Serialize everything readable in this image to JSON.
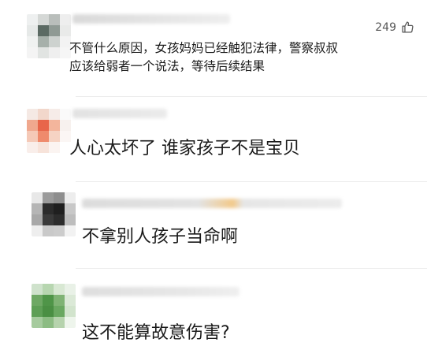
{
  "comments": [
    {
      "avatar_colors": [
        "#eef0f0",
        "#d5d8d6",
        "#b9bebb",
        "#eeeeee",
        "#e6e9e8",
        "#5b6a63",
        "#8f9a94",
        "#e9eae9",
        "#f0f2f1",
        "#a6b0aa",
        "#cdd2cf",
        "#f3f3f3",
        "#f4f4f4",
        "#e1e4e2",
        "#efefef",
        "#f6f6f6"
      ],
      "text_lines": [
        "不管什么原因，女孩妈妈已经触犯法律，警察叔叔",
        "应该给弱者一个说法，等待后续结果"
      ],
      "like_count": "249"
    },
    {
      "avatar_colors": [
        "#f5e9e4",
        "#f2d7cb",
        "#f6ece8",
        "#fafafa",
        "#f0a88e",
        "#e8664a",
        "#f3b59c",
        "#f7f1ee",
        "#f5c9b7",
        "#ef8a6c",
        "#f6d3c3",
        "#fbf6f4",
        "#f9eeea",
        "#f7e3da",
        "#fbf4f1",
        "#ffffff"
      ],
      "text": "人心太坏了 谁家孩子不是宝贝"
    },
    {
      "avatar_colors": [
        "#e8e8e8",
        "#9b9b9b",
        "#8e8e8e",
        "#ededed",
        "#b5b5b5",
        "#2b2b2b",
        "#1f1f1f",
        "#c8c8c8",
        "#a8a8a8",
        "#3a3a3a",
        "#2c2c2c",
        "#bdbdbd",
        "#eeeeee",
        "#c9c9c9",
        "#cccccc",
        "#f2f2f2"
      ],
      "text": "不拿别人孩子当命啊"
    },
    {
      "avatar_colors": [
        "#cfe2cc",
        "#b7d6b0",
        "#d8e8d3",
        "#e9f1e7",
        "#6ea864",
        "#4f9548",
        "#7fb374",
        "#dbe9d7",
        "#5e9f56",
        "#4a8f43",
        "#6aa861",
        "#d2e4cd",
        "#a6cb9e",
        "#8cbc83",
        "#b6d3ad",
        "#eef5ec"
      ],
      "text": "这不能算故意伤害?"
    }
  ]
}
